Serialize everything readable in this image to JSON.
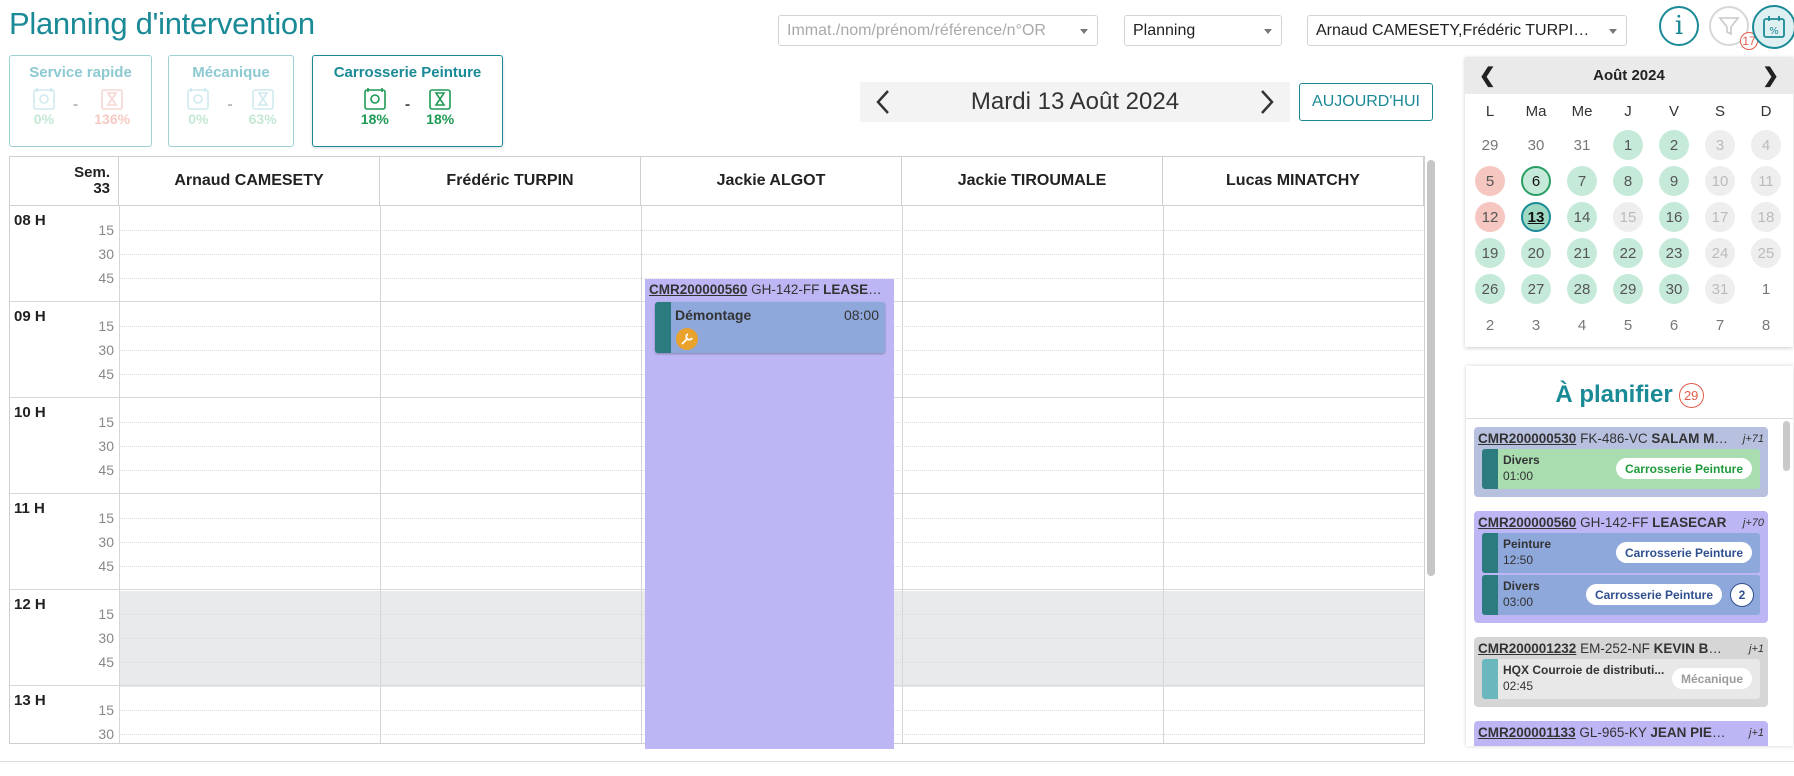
{
  "header": {
    "title": "Planning d'intervention",
    "search_placeholder": "Immat./nom/prénom/référence/n°OR",
    "view_select": "Planning",
    "technicians_select": "Arnaud CAMESETY,Frédéric TURPIN,...",
    "info_label": "i",
    "filter_count": "17"
  },
  "services": [
    {
      "name": "Service rapide",
      "pct_a": "0%",
      "pct_b": "136%",
      "active": false
    },
    {
      "name": "Mécanique",
      "pct_a": "0%",
      "pct_b": "63%",
      "active": false
    },
    {
      "name": "Carrosserie Peinture",
      "pct_a": "18%",
      "pct_b": "18%",
      "active": true
    }
  ],
  "service_separator": "-",
  "datebar": {
    "date": "Mardi 13 Août 2024",
    "today_label": "AUJOURD'HUI"
  },
  "grid": {
    "week_label": "Sem.",
    "week_number": "33",
    "columns": [
      "Arnaud CAMESETY",
      "Frédéric TURPIN",
      "Jackie ALGOT",
      "Jackie TIROUMALE",
      "Lucas MINATCHY"
    ],
    "hours": [
      "08 H",
      "09 H",
      "10 H",
      "11 H",
      "12 H",
      "13 H"
    ],
    "quarters": [
      "15",
      "30",
      "45"
    ]
  },
  "appointment": {
    "ref": "CMR200000560",
    "plate": "GH-142-FF",
    "client": "LEASECAR",
    "task_name": "Démontage",
    "task_time": "08:00"
  },
  "mini_calendar": {
    "month": "Août 2024",
    "prev": "❮",
    "next": "❯",
    "weekdays": [
      "L",
      "Ma",
      "Me",
      "J",
      "V",
      "S",
      "D"
    ],
    "weeks": [
      [
        {
          "d": "29",
          "s": "out"
        },
        {
          "d": "30",
          "s": "out"
        },
        {
          "d": "31",
          "s": "out"
        },
        {
          "d": "1",
          "s": "avail"
        },
        {
          "d": "2",
          "s": "avail"
        },
        {
          "d": "3",
          "s": "wk"
        },
        {
          "d": "4",
          "s": "wk"
        }
      ],
      [
        {
          "d": "5",
          "s": "past"
        },
        {
          "d": "6",
          "s": "today"
        },
        {
          "d": "7",
          "s": "avail"
        },
        {
          "d": "8",
          "s": "avail"
        },
        {
          "d": "9",
          "s": "avail"
        },
        {
          "d": "10",
          "s": "wk"
        },
        {
          "d": "11",
          "s": "wk"
        }
      ],
      [
        {
          "d": "12",
          "s": "past"
        },
        {
          "d": "13",
          "s": "sel"
        },
        {
          "d": "14",
          "s": "avail"
        },
        {
          "d": "15",
          "s": "wk"
        },
        {
          "d": "16",
          "s": "avail"
        },
        {
          "d": "17",
          "s": "wk"
        },
        {
          "d": "18",
          "s": "wk"
        }
      ],
      [
        {
          "d": "19",
          "s": "avail"
        },
        {
          "d": "20",
          "s": "avail"
        },
        {
          "d": "21",
          "s": "avail"
        },
        {
          "d": "22",
          "s": "avail"
        },
        {
          "d": "23",
          "s": "avail"
        },
        {
          "d": "24",
          "s": "wk"
        },
        {
          "d": "25",
          "s": "wk"
        }
      ],
      [
        {
          "d": "26",
          "s": "avail"
        },
        {
          "d": "27",
          "s": "avail"
        },
        {
          "d": "28",
          "s": "avail"
        },
        {
          "d": "29",
          "s": "avail"
        },
        {
          "d": "30",
          "s": "avail"
        },
        {
          "d": "31",
          "s": "wk"
        },
        {
          "d": "1",
          "s": "out"
        }
      ],
      [
        {
          "d": "2",
          "s": "out"
        },
        {
          "d": "3",
          "s": "out"
        },
        {
          "d": "4",
          "s": "out"
        },
        {
          "d": "5",
          "s": "out"
        },
        {
          "d": "6",
          "s": "out"
        },
        {
          "d": "7",
          "s": "out"
        },
        {
          "d": "8",
          "s": "out"
        }
      ]
    ]
  },
  "to_plan": {
    "title": "À planifier",
    "count": "29",
    "orders": [
      {
        "ref": "CMR200000530",
        "plate": "FK-486-VC",
        "client": "SALAM MARC",
        "days": "j+71",
        "bg": "#b7c0de",
        "tasks": [
          {
            "name": "Divers",
            "time": "01:00",
            "service": "Carrosserie Peinture",
            "bg": "#a9ddb0",
            "pill_color": "#1f9a3a",
            "bar": "#2c7b7e"
          }
        ]
      },
      {
        "ref": "CMR200000560",
        "plate": "GH-142-FF",
        "client": "LEASECAR",
        "days": "j+70",
        "bg": "#bcb6f4",
        "tasks": [
          {
            "name": "Peinture",
            "time": "12:50",
            "service": "Carrosserie Peinture",
            "bg": "#8fa8dc",
            "pill_color": "#2f4f8f",
            "bar": "#2c7b7e"
          },
          {
            "name": "Divers",
            "time": "03:00",
            "service": "Carrosserie Peinture",
            "bg": "#8fa8dc",
            "pill_color": "#2f4f8f",
            "bar": "#2c7b7e",
            "count": "2"
          }
        ]
      },
      {
        "ref": "CMR200001232",
        "plate": "EM-252-NF",
        "client": "KEVIN BOULA",
        "days": "j+1",
        "bg": "#d6d6d6",
        "tasks": [
          {
            "name": "HQX Courroie de distributi...",
            "time": "02:45",
            "service": "Mécanique",
            "bg": "#e8e8e8",
            "pill_color": "#9a9a9a",
            "bar": "#6ab7bd"
          }
        ]
      },
      {
        "ref": "CMR200001133",
        "plate": "GL-965-KY",
        "client": "JEAN PIERRE",
        "days": "j+1",
        "bg": "#bcb6f4",
        "tasks": []
      }
    ]
  }
}
